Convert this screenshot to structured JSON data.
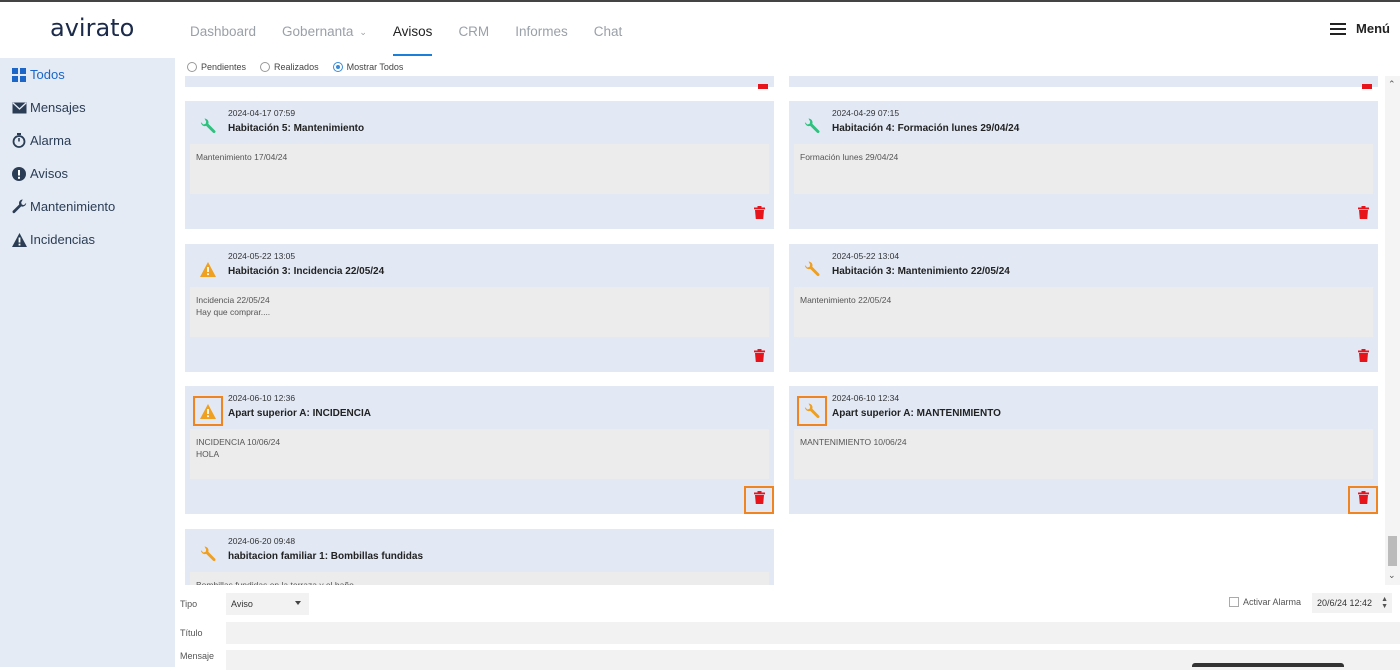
{
  "brand": {
    "logo_text": "avirato"
  },
  "nav": {
    "items": [
      {
        "label": "Dashboard",
        "active": false
      },
      {
        "label": "Gobernanta",
        "active": false,
        "dropdown": true
      },
      {
        "label": "Avisos",
        "active": true
      },
      {
        "label": "CRM",
        "active": false
      },
      {
        "label": "Informes",
        "active": false
      },
      {
        "label": "Chat",
        "active": false
      }
    ],
    "menu_label": "Menú"
  },
  "sidebar": {
    "items": [
      {
        "label": "Todos",
        "icon": "grid-icon",
        "active": true
      },
      {
        "label": "Mensajes",
        "icon": "envelope-icon",
        "active": false
      },
      {
        "label": "Alarma",
        "icon": "stopwatch-icon",
        "active": false
      },
      {
        "label": "Avisos",
        "icon": "exclamation-circle-icon",
        "active": false
      },
      {
        "label": "Mantenimiento",
        "icon": "wrench-icon",
        "active": false
      },
      {
        "label": "Incidencias",
        "icon": "warning-icon",
        "active": false
      }
    ]
  },
  "filters": {
    "options": [
      {
        "label": "Pendientes",
        "checked": false
      },
      {
        "label": "Realizados",
        "checked": false
      },
      {
        "label": "Mostrar Todos",
        "checked": true
      }
    ]
  },
  "cards": [
    {
      "date": "2024-04-17 07:59",
      "title": "Habitación 5: Mantenimiento",
      "body": "Mantenimiento 17/04/24",
      "icon": "wrench-icon",
      "icon_color": "#2ec27e",
      "highlight": false
    },
    {
      "date": "2024-04-29 07:15",
      "title": "Habitación 4: Formación lunes 29/04/24",
      "body": "Formación lunes 29/04/24",
      "icon": "wrench-icon",
      "icon_color": "#2ec27e",
      "highlight": false
    },
    {
      "date": "2024-05-22 13:05",
      "title": "Habitación 3: Incidencia 22/05/24",
      "body": "Incidencia 22/05/24\nHay que comprar....",
      "icon": "warning-icon",
      "icon_color": "#f0a020",
      "highlight": false
    },
    {
      "date": "2024-05-22 13:04",
      "title": "Habitación 3: Mantenimiento 22/05/24",
      "body": "Mantenimiento 22/05/24",
      "icon": "wrench-icon",
      "icon_color": "#f0a020",
      "highlight": false
    },
    {
      "date": "2024-06-10 12:36",
      "title": "Apart superior A: INCIDENCIA",
      "body": "INCIDENCIA 10/06/24\nHOLA",
      "icon": "warning-icon",
      "icon_color": "#f0a020",
      "highlight": true
    },
    {
      "date": "2024-06-10 12:34",
      "title": "Apart superior A: MANTENIMIENTO",
      "body": "MANTENIMIENTO 10/06/24",
      "icon": "wrench-icon",
      "icon_color": "#f0a020",
      "highlight": true
    },
    {
      "date": "2024-06-20 09:48",
      "title": "habitacion familiar 1: Bombillas fundidas",
      "body": "Bombillas fundidas en la terraza y el baño",
      "icon": "wrench-icon",
      "icon_color": "#f0a020",
      "highlight": false
    }
  ],
  "colors": {
    "trash": "#e8141c",
    "highlight": "#f08420",
    "active_link": "#1a66c9"
  },
  "form": {
    "tipo_label": "Tipo",
    "tipo_value": "Aviso",
    "titulo_label": "Título",
    "mensaje_label": "Mensaje",
    "alarm_label": "Activar Alarma",
    "datetime_value": "20/6/24 12:42"
  }
}
